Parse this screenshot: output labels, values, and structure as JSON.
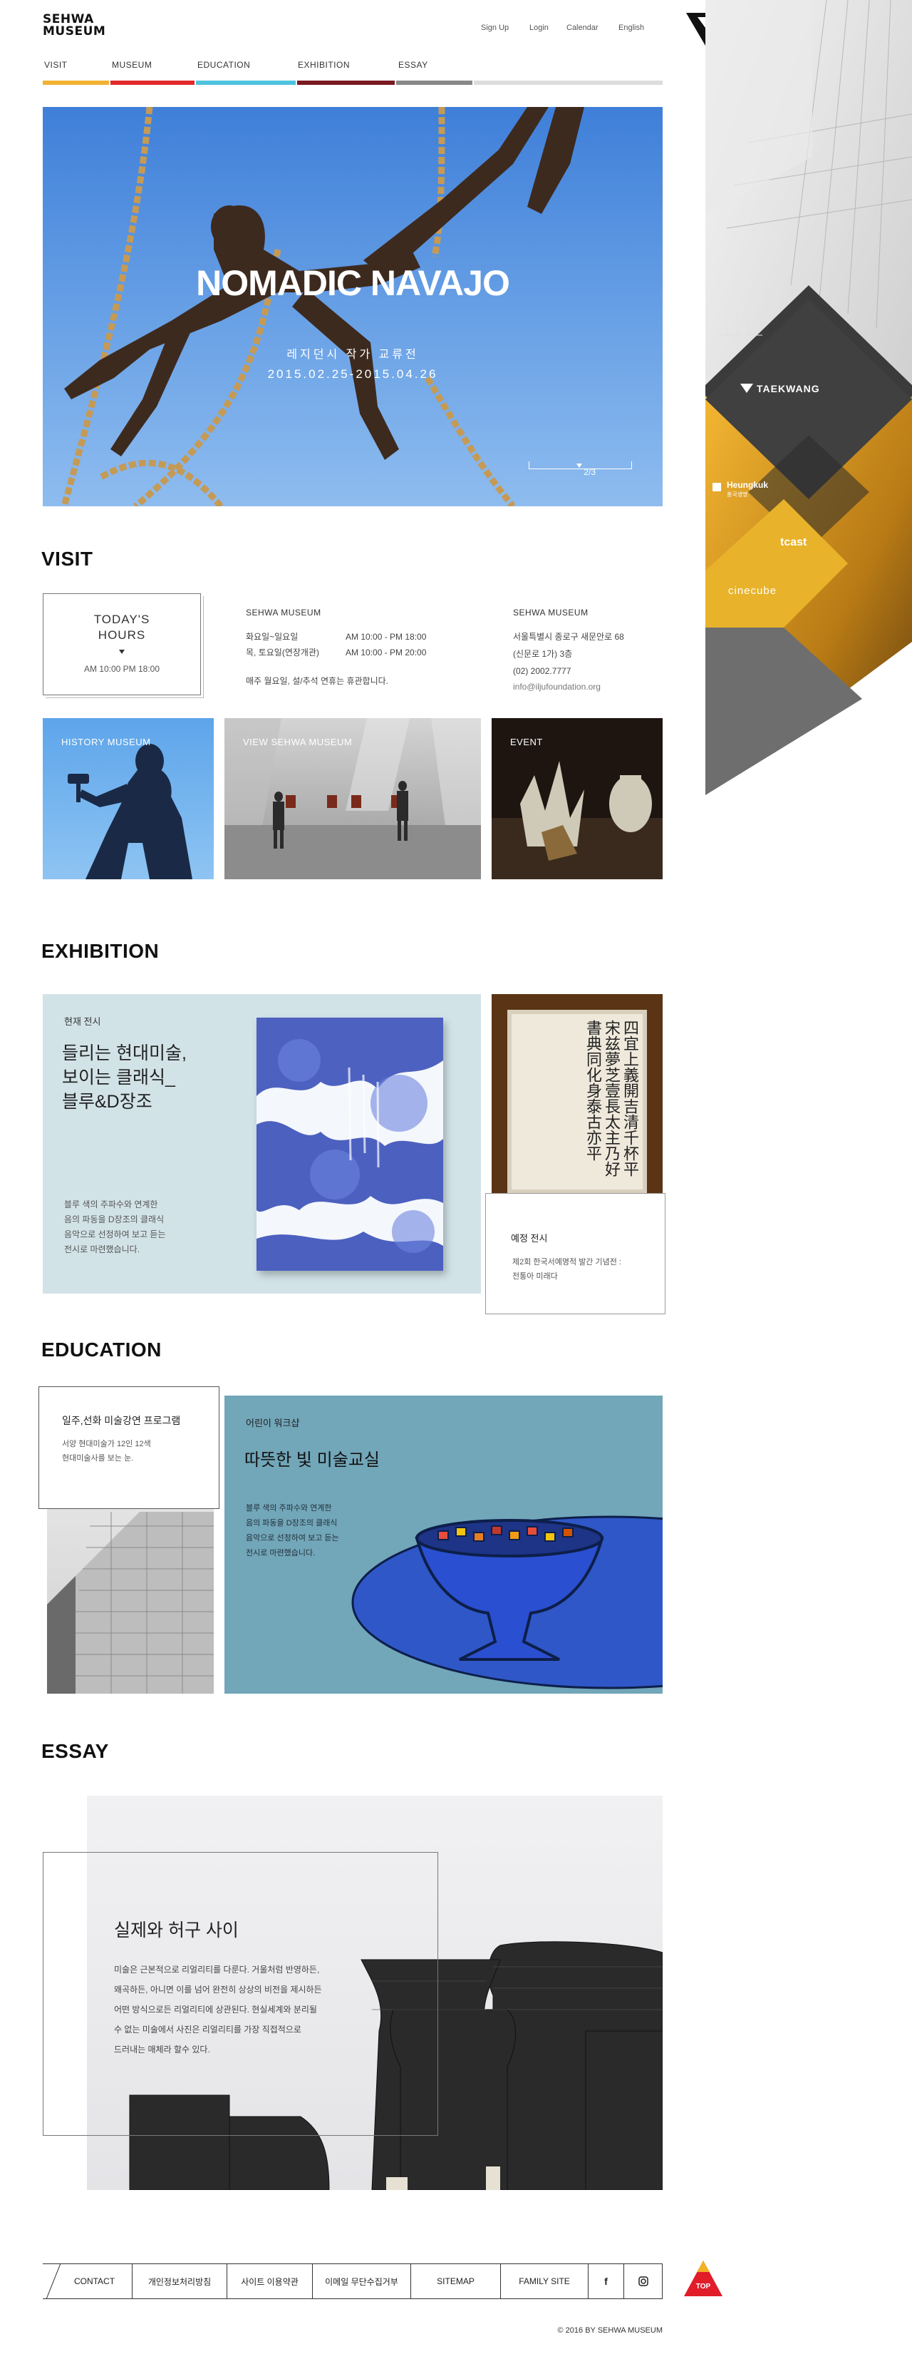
{
  "header": {
    "logo_line1": "SEHWA",
    "logo_line2": "MUSEUM",
    "util": [
      "Sign Up",
      "Login",
      "Calendar",
      "English"
    ],
    "nav": [
      {
        "label": "VISIT",
        "color": "#f2b233"
      },
      {
        "label": "MUSEUM",
        "color": "#e12a2a"
      },
      {
        "label": "EDUCATION",
        "color": "#4ec3df"
      },
      {
        "label": "EXHIBITION",
        "color": "#7a1a22"
      },
      {
        "label": "ESSAY",
        "color": "#888888"
      }
    ]
  },
  "hero": {
    "title": "NOMADIC NAVAJO",
    "subtitle": "레지던시 작가 교류전",
    "date": "2015.02.25-2015.04.26",
    "page": "2/3"
  },
  "sidebar": {
    "items": [
      "TAEKWANG",
      "Heungkuk",
      "tcast",
      "cinecube"
    ],
    "heungkuk_sub": "흥국생명"
  },
  "visit": {
    "title": "VISIT",
    "hours_title_1": "TODAY'S",
    "hours_title_2": "HOURS",
    "hours_value": "AM 10:00 PM 18:00",
    "col1_title": "SEHWA MUSEUM",
    "days1": "화요일~일요일",
    "time1": "AM 10:00 - PM 18:00",
    "days2": "목, 토요일(연장개관)",
    "time2": "AM 10:00 - PM 20:00",
    "note": "매주 월요일, 설/추석 연휴는 휴관합니다.",
    "col2_title": "SEHWA MUSEUM",
    "addr1": "서울특별시 종로구 새문안로 68",
    "addr2": "(신문로 1가) 3층",
    "phone": "(02) 2002.7777",
    "email": "info@iljufoundation.org",
    "tiles": [
      "HISTORY MUSEUM",
      "VIEW SEHWA MUSEUM",
      "EVENT"
    ]
  },
  "exhibition": {
    "title": "EXHIBITION",
    "current_label": "현재 전시",
    "current_title_1": "들리는 현대미술,",
    "current_title_2": "보이는 클래식_",
    "current_title_3": "블루&D장조",
    "current_desc_1": "블루 색의 주파수와 연계한",
    "current_desc_2": "음의 파동을 D장조의 클래식",
    "current_desc_3": "음악으로 선정하여 보고 듣는",
    "current_desc_4": "전시로 마련했습니다.",
    "upcoming_label": "예정 전시",
    "upcoming_desc_1": "제2회 한국서예명적 발간 기념전 :",
    "upcoming_desc_2": "전통아 미래다",
    "calligraphy": "四宜上義開吉清千杯平宋兹夢芝壹長太主乃好書典同化身泰古亦平"
  },
  "education": {
    "title": "EDUCATION",
    "card1_title": "일주,선화 미술강연 프로그램",
    "card1_desc_1": "서양 현대미술가 12인 12색",
    "card1_desc_2": "현대미술사를 보는 눈.",
    "card2_label": "어린이 워크샵",
    "card2_title": "따뜻한 빛 미술교실",
    "card2_desc_1": "블루 색의 주파수와 연계한",
    "card2_desc_2": "음의 파동을 D장조의 클래식",
    "card2_desc_3": "음악으로 선정하여 보고 듣는",
    "card2_desc_4": "전시로 마련했습니다."
  },
  "essay": {
    "title": "ESSAY",
    "heading": "실제와 허구 사이",
    "p1": "미술은 근본적으로 리얼리티를 다룬다. 거울처럼 반영하든,",
    "p2": "왜곡하든, 아니면 이를 넘어 완전히 상상의 비전을 제시하든",
    "p3": "어떤 방식으로든 리얼리티에 상관된다. 현실세계와 분리될",
    "p4": "수 없는 미술에서 사진은 리얼리티를 가장 직접적으로",
    "p5": "드러내는 매체라 할수 있다."
  },
  "footer": {
    "links": [
      "CONTACT",
      "개인정보처리방침",
      "사이트 이용약관",
      "이메일 무단수집거부",
      "SITEMAP",
      "FAMILY SITE"
    ],
    "facebook": "f",
    "top": "TOP",
    "copyright": "© 2016 BY SEHWA MUSEUM"
  }
}
